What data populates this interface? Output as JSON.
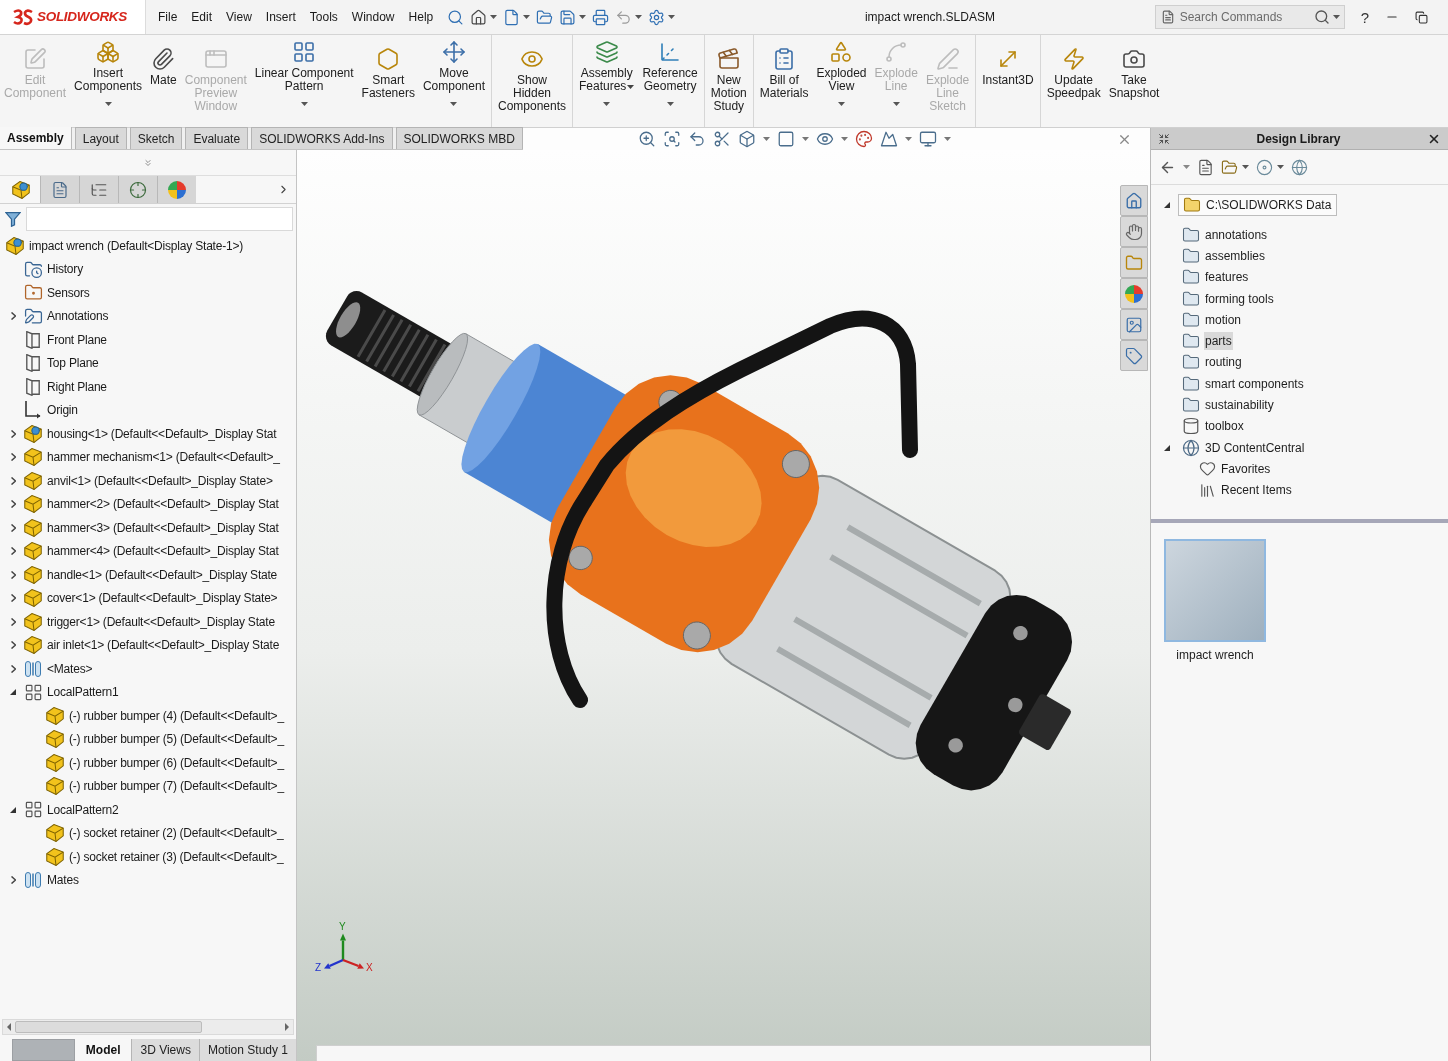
{
  "titlebar": {
    "logo_text": "SOLIDWORKS",
    "menus": [
      "File",
      "Edit",
      "View",
      "Insert",
      "Tools",
      "Window",
      "Help"
    ],
    "document_title": "impact wrench.SLDASM",
    "search": {
      "placeholder": "Search Commands"
    },
    "help": "?"
  },
  "ribbon": {
    "groups": [
      {
        "items": [
          {
            "lines": [
              "Edit",
              "Component"
            ],
            "disabled": true,
            "dropdown": false,
            "inline_dropdown": false
          },
          {
            "lines": [
              "Insert",
              "Components"
            ],
            "disabled": false,
            "dropdown": true,
            "inline_dropdown": false
          },
          {
            "lines": [
              "Mate"
            ],
            "disabled": false,
            "dropdown": false,
            "inline_dropdown": false
          },
          {
            "lines": [
              "Component",
              "Preview",
              "Window"
            ],
            "disabled": true,
            "dropdown": false,
            "inline_dropdown": false
          },
          {
            "lines": [
              "Linear Component",
              "Pattern"
            ],
            "disabled": false,
            "dropdown": true,
            "inline_dropdown": false
          },
          {
            "lines": [
              "Smart",
              "Fasteners"
            ],
            "disabled": false,
            "dropdown": false,
            "inline_dropdown": false
          },
          {
            "lines": [
              "Move",
              "Component"
            ],
            "disabled": false,
            "dropdown": true,
            "inline_dropdown": false
          }
        ]
      },
      {
        "items": [
          {
            "lines": [
              "Show",
              "Hidden",
              "Components"
            ],
            "disabled": false,
            "dropdown": false,
            "inline_dropdown": false
          }
        ]
      },
      {
        "items": [
          {
            "lines": [
              "Assembly",
              "Features"
            ],
            "disabled": false,
            "dropdown": true,
            "inline_dropdown": true
          },
          {
            "lines": [
              "Reference",
              "Geometry"
            ],
            "disabled": false,
            "dropdown": true,
            "inline_dropdown": false
          }
        ]
      },
      {
        "items": [
          {
            "lines": [
              "New",
              "Motion",
              "Study"
            ],
            "disabled": false,
            "dropdown": false,
            "inline_dropdown": false
          }
        ]
      },
      {
        "items": [
          {
            "lines": [
              "Bill of",
              "Materials"
            ],
            "disabled": false,
            "dropdown": false,
            "inline_dropdown": false
          },
          {
            "lines": [
              "Exploded",
              "View"
            ],
            "disabled": false,
            "dropdown": true,
            "inline_dropdown": false
          },
          {
            "lines": [
              "Explode",
              "Line"
            ],
            "disabled": true,
            "dropdown": true,
            "inline_dropdown": false
          },
          {
            "lines": [
              "Explode",
              "Line",
              "Sketch"
            ],
            "disabled": true,
            "dropdown": false,
            "inline_dropdown": false
          }
        ]
      },
      {
        "items": [
          {
            "lines": [
              "Instant3D"
            ],
            "disabled": false,
            "dropdown": false,
            "inline_dropdown": false
          }
        ]
      },
      {
        "items": [
          {
            "lines": [
              "Update",
              "Speedpak"
            ],
            "disabled": false,
            "dropdown": false,
            "inline_dropdown": false
          },
          {
            "lines": [
              "Take",
              "Snapshot"
            ],
            "disabled": false,
            "dropdown": false,
            "inline_dropdown": false
          }
        ]
      }
    ]
  },
  "command_tabs": [
    {
      "label": "Assembly",
      "selected": true
    },
    {
      "label": "Layout",
      "selected": false
    },
    {
      "label": "Sketch",
      "selected": false
    },
    {
      "label": "Evaluate",
      "selected": false
    },
    {
      "label": "SOLIDWORKS Add-Ins",
      "selected": false
    },
    {
      "label": "SOLIDWORKS MBD",
      "selected": false
    }
  ],
  "feature_manager": {
    "tabs": [
      {
        "selected": true
      },
      {
        "selected": false
      },
      {
        "selected": false
      },
      {
        "selected": false
      },
      {
        "selected": false
      }
    ],
    "tree": [
      {
        "label": "impact wrench (Default<Display State-1>)",
        "kind": "assembly",
        "children": [
          {
            "label": "History",
            "kind": "history"
          },
          {
            "label": "Sensors",
            "kind": "sensors"
          },
          {
            "label": "Annotations",
            "kind": "annotations",
            "expanded": false
          },
          {
            "label": "Front Plane",
            "kind": "plane"
          },
          {
            "label": "Top Plane",
            "kind": "plane"
          },
          {
            "label": "Right Plane",
            "kind": "plane"
          },
          {
            "label": "Origin",
            "kind": "origin"
          },
          {
            "label": "housing<1> (Default<<Default>_Display Stat",
            "kind": "assembly",
            "expanded": false
          },
          {
            "label": "hammer mechanism<1> (Default<<Default>_",
            "kind": "part",
            "expanded": false
          },
          {
            "label": "anvil<1> (Default<<Default>_Display State>",
            "kind": "part",
            "expanded": false
          },
          {
            "label": "hammer<2> (Default<<Default>_Display Stat",
            "kind": "part",
            "expanded": false
          },
          {
            "label": "hammer<3> (Default<<Default>_Display Stat",
            "kind": "part",
            "expanded": false
          },
          {
            "label": "hammer<4> (Default<<Default>_Display Stat",
            "kind": "part",
            "expanded": false
          },
          {
            "label": "handle<1> (Default<<Default>_Display State",
            "kind": "part",
            "expanded": false
          },
          {
            "label": "cover<1> (Default<<Default>_Display State>",
            "kind": "part",
            "expanded": false
          },
          {
            "label": "trigger<1> (Default<<Default>_Display State",
            "kind": "part",
            "expanded": false
          },
          {
            "label": "air inlet<1> (Default<<Default>_Display State",
            "kind": "part",
            "expanded": false
          },
          {
            "label": "<Mates>",
            "kind": "mates",
            "expanded": false
          },
          {
            "label": "LocalPattern1",
            "kind": "pattern",
            "expanded": true,
            "children": [
              {
                "label": "(-) rubber bumper (4) (Default<<Default>_",
                "kind": "part"
              },
              {
                "label": "(-) rubber bumper (5) (Default<<Default>_",
                "kind": "part"
              },
              {
                "label": "(-) rubber bumper (6) (Default<<Default>_",
                "kind": "part"
              },
              {
                "label": "(-) rubber bumper (7) (Default<<Default>_",
                "kind": "part"
              }
            ]
          },
          {
            "label": "LocalPattern2",
            "kind": "pattern",
            "expanded": true,
            "children": [
              {
                "label": "(-) socket retainer (2) (Default<<Default>_",
                "kind": "part"
              },
              {
                "label": "(-) socket retainer (3) (Default<<Default>_",
                "kind": "part"
              }
            ]
          },
          {
            "label": "Mates",
            "kind": "mates",
            "expanded": false
          }
        ]
      }
    ],
    "bottom_tabs": [
      {
        "label": "Model",
        "selected": true
      },
      {
        "label": "3D Views",
        "selected": false
      },
      {
        "label": "Motion Study 1",
        "selected": false
      }
    ]
  },
  "viewport": {
    "triad_labels": [
      "Y",
      "Z",
      "X"
    ]
  },
  "design_library": {
    "title": "Design Library",
    "tree": [
      {
        "label": "C:\\SOLIDWORKS Data",
        "kind": "drive",
        "expanded": true,
        "selected": false,
        "children": [
          {
            "label": "annotations",
            "kind": "folder",
            "selected": false
          },
          {
            "label": "assemblies",
            "kind": "folder",
            "selected": false
          },
          {
            "label": "features",
            "kind": "folder",
            "selected": false
          },
          {
            "label": "forming tools",
            "kind": "folder",
            "selected": false
          },
          {
            "label": "motion",
            "kind": "folder",
            "selected": false
          },
          {
            "label": "parts",
            "kind": "folder",
            "selected": true
          },
          {
            "label": "routing",
            "kind": "folder",
            "selected": false
          },
          {
            "label": "smart components",
            "kind": "folder",
            "selected": false
          },
          {
            "label": "sustainability",
            "kind": "folder",
            "selected": false
          },
          {
            "label": "toolbox",
            "kind": "toolbox",
            "selected": false
          }
        ]
      },
      {
        "label": "3D ContentCentral",
        "kind": "web",
        "expanded": true,
        "selected": false,
        "children": [
          {
            "label": "Favorites",
            "kind": "favorites",
            "selected": false
          },
          {
            "label": "Recent Items",
            "kind": "recent",
            "selected": false
          }
        ]
      }
    ],
    "thumbnails": [
      {
        "label": "impact wrench"
      }
    ]
  }
}
